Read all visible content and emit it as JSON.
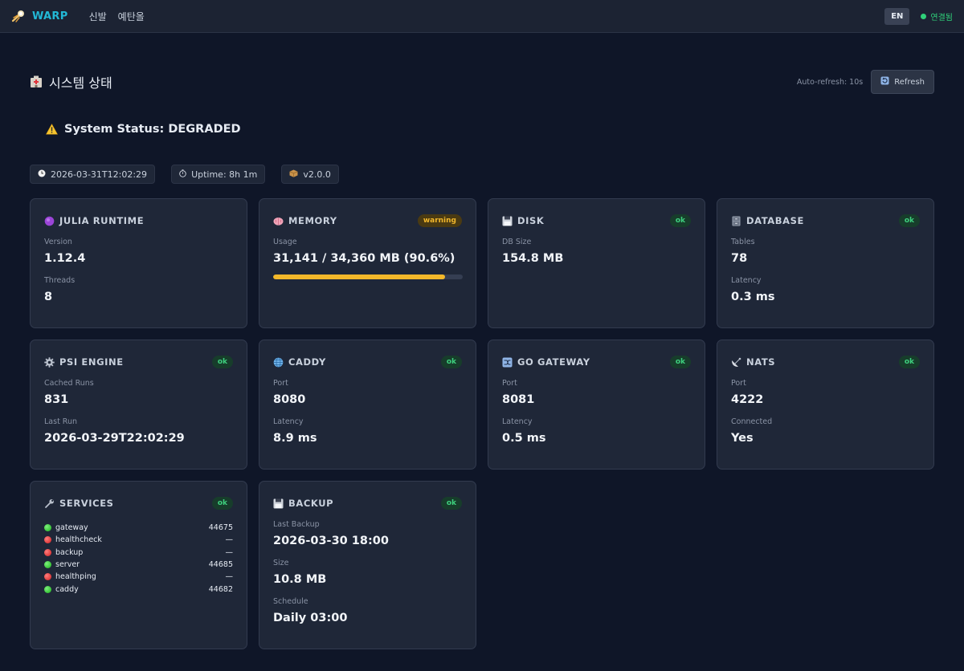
{
  "topbar": {
    "brand": "WARP",
    "nav": [
      "신발",
      "예탄올"
    ],
    "lang": "EN",
    "connection": "연결됨"
  },
  "header": {
    "title": "시스템 상태",
    "auto_refresh": "Auto-refresh: 10s",
    "refresh_label": "Refresh"
  },
  "status": {
    "text": "System Status: DEGRADED"
  },
  "chips": {
    "timestamp": "2026-03-31T12:02:29",
    "uptime": "Uptime: 8h 1m",
    "version": "v2.0.0"
  },
  "cards": {
    "julia": {
      "title": "JULIA RUNTIME",
      "f1_label": "Version",
      "f1_value": "1.12.4",
      "f2_label": "Threads",
      "f2_value": "8"
    },
    "memory": {
      "title": "MEMORY",
      "badge": "warning",
      "f1_label": "Usage",
      "f1_value": "31,141 / 34,360 MB (90.6%)",
      "usage_fraction": 0.906
    },
    "disk": {
      "title": "DISK",
      "badge": "ok",
      "f1_label": "DB Size",
      "f1_value": "154.8 MB"
    },
    "database": {
      "title": "DATABASE",
      "badge": "ok",
      "f1_label": "Tables",
      "f1_value": "78",
      "f2_label": "Latency",
      "f2_value": "0.3 ms"
    },
    "psi": {
      "title": "PSI ENGINE",
      "badge": "ok",
      "f1_label": "Cached Runs",
      "f1_value": "831",
      "f2_label": "Last Run",
      "f2_value": "2026-03-29T22:02:29"
    },
    "caddy": {
      "title": "CADDY",
      "badge": "ok",
      "f1_label": "Port",
      "f1_value": "8080",
      "f2_label": "Latency",
      "f2_value": "8.9 ms"
    },
    "gateway": {
      "title": "GO GATEWAY",
      "badge": "ok",
      "f1_label": "Port",
      "f1_value": "8081",
      "f2_label": "Latency",
      "f2_value": "0.5 ms"
    },
    "nats": {
      "title": "NATS",
      "badge": "ok",
      "f1_label": "Port",
      "f1_value": "4222",
      "f2_label": "Connected",
      "f2_value": "Yes"
    },
    "services": {
      "title": "SERVICES",
      "badge": "ok",
      "items": [
        {
          "name": "gateway",
          "status": "up",
          "pid": "44675"
        },
        {
          "name": "healthcheck",
          "status": "down",
          "pid": "—"
        },
        {
          "name": "backup",
          "status": "down",
          "pid": "—"
        },
        {
          "name": "server",
          "status": "up",
          "pid": "44685"
        },
        {
          "name": "healthping",
          "status": "down",
          "pid": "—"
        },
        {
          "name": "caddy",
          "status": "up",
          "pid": "44682"
        }
      ]
    },
    "backup": {
      "title": "BACKUP",
      "badge": "ok",
      "f1_label": "Last Backup",
      "f1_value": "2026-03-30 18:00",
      "f2_label": "Size",
      "f2_value": "10.8 MB",
      "f3_label": "Schedule",
      "f3_value": "Daily 03:00"
    }
  }
}
